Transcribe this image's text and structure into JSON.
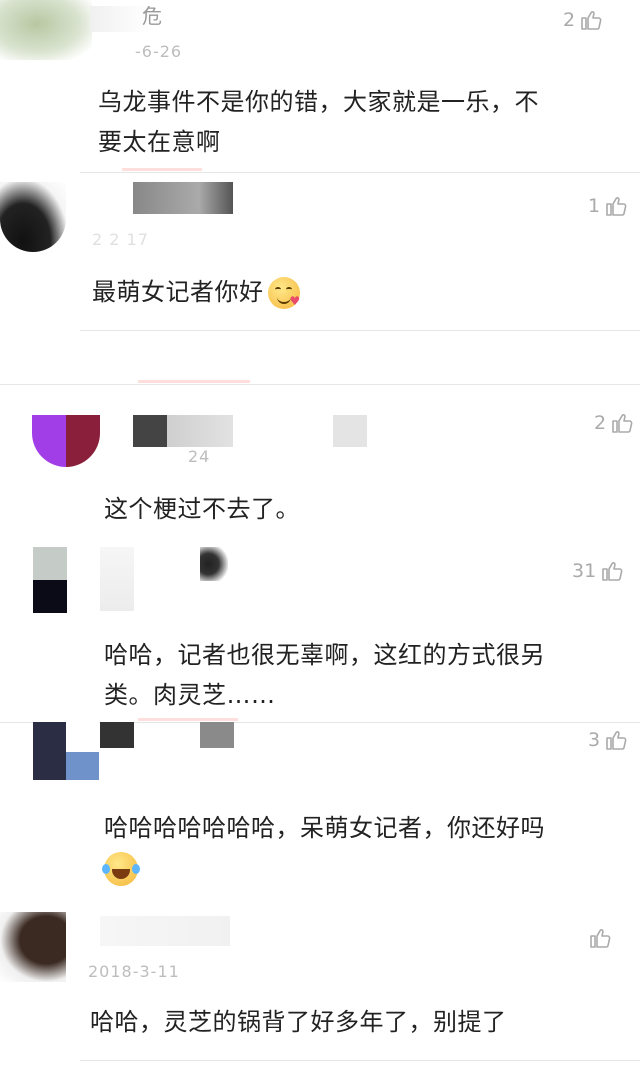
{
  "comments": [
    {
      "username_partial": "危",
      "date": "-6-26",
      "likes": "2",
      "text_lines": [
        "乌龙事件不是你的错，大家就是一乐，不",
        "要太在意啊"
      ]
    },
    {
      "date": "2  2  17",
      "likes": "1",
      "text": "最萌女记者你好",
      "emoji": "face-blowing-kiss-icon"
    },
    {
      "date": "24",
      "likes": "2",
      "text": "这个梗过不去了。"
    },
    {
      "date": "",
      "likes": "31",
      "text_lines": [
        "哈哈，记者也很无辜啊，这红的方式很另",
        "类。肉灵芝……"
      ]
    },
    {
      "date": "",
      "likes": "3",
      "text_lines": [
        "哈哈哈哈哈哈哈，呆萌女记者，你还好吗"
      ],
      "emoji": "face-with-tears-of-joy-icon"
    },
    {
      "date": "2018-3-11",
      "likes": "",
      "text": "哈哈，灵芝的锅背了好多年了，别提了"
    }
  ],
  "colors": {
    "like_icon": "#aaaaaa",
    "divider": "#e6e6e6",
    "date": "#bdbdbd"
  }
}
